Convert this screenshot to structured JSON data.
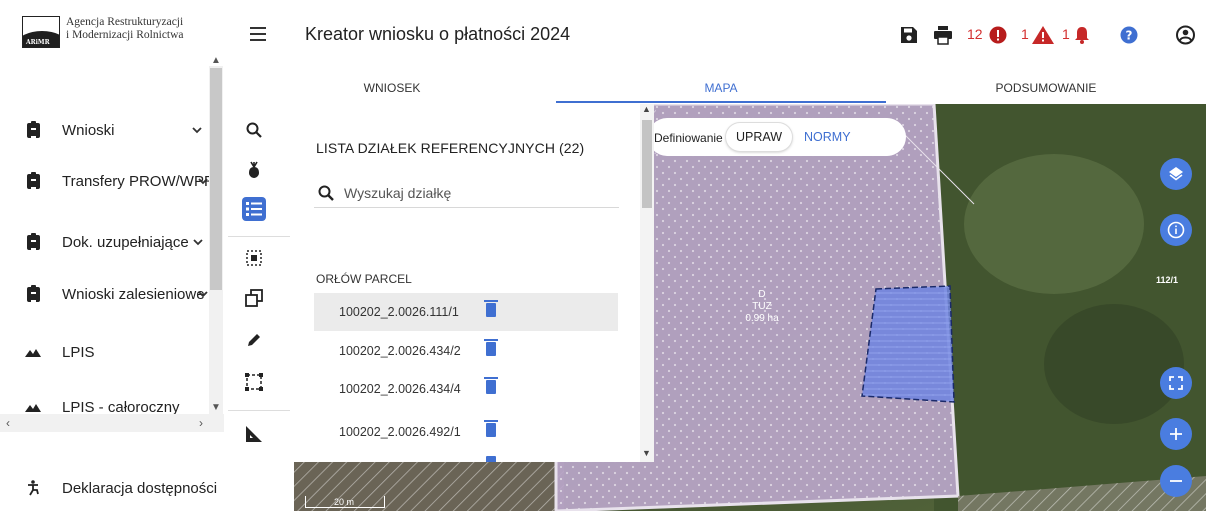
{
  "app": {
    "title": "Kreator wniosku o płatności 2024",
    "org_line1": "Agencja Restrukturyzacji",
    "org_line2": "i Modernizacji Rolnictwa",
    "logo_abbr": "ARiMR"
  },
  "header": {
    "error_count": "12",
    "warning_count": "1",
    "notification_count": "1",
    "icons": [
      "save-icon",
      "print-icon",
      "error-icon",
      "warning-icon",
      "bell-icon",
      "help-icon",
      "account-icon"
    ]
  },
  "sidebar": {
    "items": [
      {
        "label": "Wnioski",
        "icon": "clipboard-icon",
        "expandable": true
      },
      {
        "label": "Transfery PROW/WPR",
        "icon": "clipboard-icon",
        "expandable": true
      },
      {
        "label": "Dok. uzupełniające",
        "icon": "clipboard-icon",
        "expandable": true
      },
      {
        "label": "Wnioski zalesieniowe",
        "icon": "clipboard-icon",
        "expandable": true
      },
      {
        "label": "LPIS",
        "icon": "terrain-icon",
        "expandable": false
      },
      {
        "label": "LPIS - całoroczny",
        "icon": "terrain-icon",
        "expandable": false
      }
    ],
    "accessibility": {
      "label": "Deklaracja dostępności",
      "icon": "accessibility-icon"
    }
  },
  "tabs": [
    {
      "label": "WNIOSEK",
      "active": false
    },
    {
      "label": "MAPA",
      "active": true
    },
    {
      "label": "PODSUMOWANIE",
      "active": false
    }
  ],
  "tools": [
    "search-icon",
    "crop-icon",
    "list-icon",
    "select-area-icon",
    "copy-shape-icon",
    "pencil-icon",
    "bounding-box-icon",
    "ruler-icon"
  ],
  "parcel_panel": {
    "title": "LISTA DZIAŁEK REFERENCYJNYCH (22)",
    "search_placeholder": "Wyszukaj działkę",
    "group": "ORŁÓW PARCEL",
    "parcels": [
      {
        "id": "100202_2.0026.111/1",
        "selected": true
      },
      {
        "id": "100202_2.0026.434/2",
        "selected": false
      },
      {
        "id": "100202_2.0026.434/4",
        "selected": false
      },
      {
        "id": "100202_2.0026.492/1",
        "selected": false
      }
    ]
  },
  "mode_toggle": {
    "label": "Definiowanie",
    "options": [
      "UPRAW",
      "NORMY"
    ],
    "selected": "UPRAW"
  },
  "map": {
    "parcel_label_line1": "D",
    "parcel_label_line2": "TUZ",
    "parcel_label_area": "0.99 ha",
    "parcel_number": "112/1",
    "scale": "20 m",
    "buttons": [
      "layers-icon",
      "info-icon",
      "fullscreen-icon",
      "zoom-in-icon",
      "zoom-out-icon"
    ]
  },
  "colors": {
    "accent": "#3f6fd1",
    "error": "#d32f2f",
    "parcel_fill": "#b9a6c8",
    "crop_fill": "#6f84e0"
  }
}
